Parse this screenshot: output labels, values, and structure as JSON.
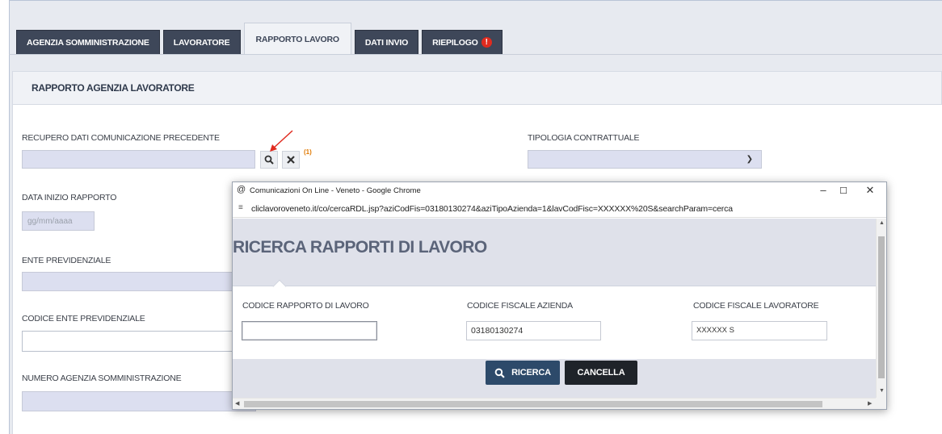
{
  "tabs": [
    {
      "label": "AGENZIA SOMMINISTRAZIONE"
    },
    {
      "label": "LAVORATORE"
    },
    {
      "label": "RAPPORTO LAVORO"
    },
    {
      "label": "DATI INVIO"
    },
    {
      "label": "RIEPILOGO"
    }
  ],
  "section": {
    "title": "RAPPORTO AGENZIA LAVORATORE"
  },
  "form": {
    "recupero_label": "RECUPERO DATI COMUNICAZIONE PRECEDENTE",
    "recupero_note": "(1)",
    "tipologia_label": "TIPOLOGIA CONTRATTUALE",
    "data_inizio_label": "DATA INIZIO RAPPORTO",
    "data_inizio_placeholder": "gg/mm/aaaa",
    "ente_label": "ENTE PREVIDENZIALE",
    "codice_ente_label": "CODICE ENTE PREVIDENZIALE",
    "numero_agenzia_label": "NUMERO AGENZIA SOMMINISTRAZIONE"
  },
  "popup": {
    "window_title": "Comunicazioni On Line - Veneto - Google Chrome",
    "url": "cliclavoroveneto.it/co/cercaRDL.jsp?aziCodFis=03180130274&aziTipoAzienda=1&lavCodFisc=XXXXXX%20S&searchParam=cerca",
    "title": "RICERCA RAPPORTI DI LAVORO",
    "codice_rapporto_label": "CODICE RAPPORTO DI LAVORO",
    "codice_rapporto_value": "",
    "codice_azienda_label": "CODICE FISCALE AZIENDA",
    "codice_azienda_value": "03180130274",
    "codice_lavoratore_label": "CODICE FISCALE LAVORATORE",
    "codice_lavoratore_value": "XXXXXX S",
    "ricerca_label": "RICERCA",
    "cancella_label": "CANCELLA"
  },
  "colors": {
    "tab_dark": "#3e4759",
    "button_ricerca": "#2d4a6a",
    "button_cancella": "#1f2329",
    "warning": "#e02b1f",
    "annotation_arrow": "#e02b1f"
  },
  "icons": {
    "search": "search-icon",
    "clear": "close-icon",
    "warning": "warning-icon"
  }
}
